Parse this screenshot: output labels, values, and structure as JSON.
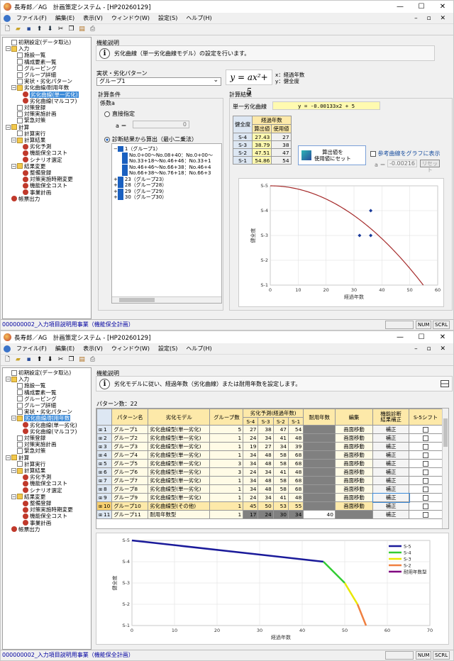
{
  "w1": {
    "title": "長寿郎／AG　計画策定システム - [HP20260129]",
    "menus": [
      "ファイル(F)",
      "編集(E)",
      "表示(V)",
      "ウィンドウ(W)",
      "設定(S)",
      "ヘルプ(H)"
    ],
    "status": "000000002_入力項目説明用事業（機能保全計画）",
    "status_num": "NUM",
    "status_scrl": "SCRL",
    "func_label": "機能説明",
    "func_text": "劣化曲線（単一劣化曲線モデル）の設定を行います。",
    "pattern_label": "実状・劣化パターン",
    "pattern_value": "グループ1",
    "formula_note_x": "x：経過年数",
    "formula_note_y": "y：健全度",
    "cond_label": "計算条件",
    "coef_label": "係数a",
    "radio_direct": "直接指定",
    "a_label": "a ＝",
    "a_value": "0",
    "radio_diag": "診断結果から算出（最小二乗法）",
    "subtree": [
      "1（グループ1）",
      "No.0+00～No.08+40：No.0+00～",
      "No.33+18～No.46+46：No.33+1",
      "No.46+46～No.66+38：No.46+4",
      "No.66+38～No.76+18：No.66+3",
      "23（グループ23）",
      "28（グループ28）",
      "29（グループ29）",
      "30（グループ30）"
    ],
    "result_label": "計算結果",
    "single_curve_label": "単一劣化曲線",
    "single_curve_eq": "y = -0.00133x2 + 5",
    "table_head_health": "健全度",
    "table_head_years": "経過年数",
    "table_head_calc": "算出値",
    "table_head_used": "使用値",
    "table_rows": [
      [
        "S-4",
        "27.43",
        "27"
      ],
      [
        "S-3",
        "38.79",
        "38"
      ],
      [
        "S-2",
        "47.51",
        "47"
      ],
      [
        "S-1",
        "54.86",
        "54"
      ]
    ],
    "btn_set": "算出値を\n使用値にセット",
    "ref_curve_label": "参考曲線をグラフに表示",
    "ref_a_label": "a ＝",
    "ref_a_value": "-0.00216",
    "reset_label": "リセット"
  },
  "tree": [
    {
      "label": "初期設定(データ取込)",
      "icon": "doc",
      "lvl": 1
    },
    {
      "label": "入力",
      "icon": "fold",
      "lvl": 0
    },
    {
      "label": "施設一覧",
      "icon": "doc",
      "lvl": 2
    },
    {
      "label": "構成要素一覧",
      "icon": "doc",
      "lvl": 2
    },
    {
      "label": "グルーピング",
      "icon": "doc",
      "lvl": 2
    },
    {
      "label": "グループ詳細",
      "icon": "doc",
      "lvl": 2
    },
    {
      "label": "実状・劣化パターン",
      "icon": "doc",
      "lvl": 2
    },
    {
      "label": "劣化曲線/耐用年数",
      "icon": "fold",
      "lvl": 1
    },
    {
      "label": "劣化曲線(単一劣化)",
      "icon": "red",
      "lvl": 3
    },
    {
      "label": "劣化曲線(マルコフ)",
      "icon": "red",
      "lvl": 3
    },
    {
      "label": "対策登録",
      "icon": "doc",
      "lvl": 2
    },
    {
      "label": "対策実施計画",
      "icon": "doc",
      "lvl": 2
    },
    {
      "label": "緊急対策",
      "icon": "doc",
      "lvl": 2
    },
    {
      "label": "計算",
      "icon": "fold",
      "lvl": 0
    },
    {
      "label": "計算実行",
      "icon": "doc",
      "lvl": 2
    },
    {
      "label": "計算結果",
      "icon": "fold",
      "lvl": 1
    },
    {
      "label": "劣化予測",
      "icon": "red",
      "lvl": 3
    },
    {
      "label": "機能保全コスト",
      "icon": "red",
      "lvl": 3
    },
    {
      "label": "シナリオ選定",
      "icon": "red",
      "lvl": 3
    },
    {
      "label": "結果変更",
      "icon": "fold",
      "lvl": 1
    },
    {
      "label": "整備登録",
      "icon": "red",
      "lvl": 3
    },
    {
      "label": "対策実施時期変更",
      "icon": "red",
      "lvl": 3
    },
    {
      "label": "機能保全コスト",
      "icon": "red",
      "lvl": 3
    },
    {
      "label": "事業計画",
      "icon": "red",
      "lvl": 3
    },
    {
      "label": "帳票出力",
      "icon": "red",
      "lvl": 1
    }
  ],
  "chart_data": [
    {
      "type": "line+scatter",
      "xlabel": "経過年数",
      "ylabel": "健全度",
      "xlim": [
        0,
        60
      ],
      "xticks": [
        "0",
        "10",
        "20",
        "30",
        "40",
        "50",
        "60"
      ],
      "yticks": [
        "S-1",
        "S-2",
        "S-3",
        "S-4",
        "S-5"
      ],
      "curve_a": -0.00133,
      "points": [
        [
          32,
          3
        ],
        [
          36,
          3
        ],
        [
          36,
          4
        ]
      ]
    },
    {
      "type": "line",
      "xlabel": "経過年数",
      "ylabel": "健全度",
      "xlim": [
        0,
        70
      ],
      "xticks": [
        "0",
        "10",
        "20",
        "30",
        "40",
        "50",
        "60",
        "70"
      ],
      "yticks": [
        "S-1",
        "S-2",
        "S-3",
        "S-4",
        "S-5"
      ],
      "series": [
        {
          "name": "S-5",
          "color": "#1a1a9a",
          "points": [
            [
              0,
              5
            ],
            [
              45,
              4
            ]
          ]
        },
        {
          "name": "S-4",
          "color": "#33cc33",
          "points": [
            [
              45,
              4
            ],
            [
              50,
              3
            ]
          ]
        },
        {
          "name": "S-3",
          "color": "#e8e800",
          "points": [
            [
              50,
              3
            ],
            [
              53,
              2
            ]
          ]
        },
        {
          "name": "S-2",
          "color": "#f08040",
          "points": [
            [
              53,
              2
            ],
            [
              55,
              1
            ]
          ]
        },
        {
          "name": "耐用年数型",
          "color": "#800080",
          "points": []
        }
      ]
    }
  ],
  "w2": {
    "title": "長寿郎／AG　計画策定システム - [HP20260129]",
    "func_label": "機能説明",
    "func_text": "劣化モデルに従い、経過年数（劣化曲線）または耐用年数を設定します。",
    "pattern_count": "パターン数：22",
    "headers": [
      "パターン名",
      "劣化モデル",
      "グループ数",
      "劣化予測(経過年数)",
      "S-4",
      "S-3",
      "S-2",
      "S-1",
      "耐用年数",
      "編集",
      "機能診断\n結果補正",
      "S-5シフト"
    ],
    "rows": [
      [
        "1",
        "グループ1",
        "劣化曲線型(単一劣化)",
        "5",
        "27",
        "38",
        "47",
        "54",
        "",
        "画面移動",
        "補正"
      ],
      [
        "2",
        "グループ2",
        "劣化曲線型(単一劣化)",
        "1",
        "24",
        "34",
        "41",
        "48",
        "",
        "画面移動",
        "補正"
      ],
      [
        "3",
        "グループ3",
        "劣化曲線型(単一劣化)",
        "1",
        "19",
        "27",
        "34",
        "39",
        "",
        "画面移動",
        "補正"
      ],
      [
        "4",
        "グループ4",
        "劣化曲線型(単一劣化)",
        "1",
        "34",
        "48",
        "58",
        "68",
        "",
        "画面移動",
        "補正"
      ],
      [
        "5",
        "グループ5",
        "劣化曲線型(単一劣化)",
        "3",
        "34",
        "48",
        "58",
        "68",
        "",
        "画面移動",
        "補正"
      ],
      [
        "6",
        "グループ6",
        "劣化曲線型(単一劣化)",
        "3",
        "24",
        "34",
        "41",
        "48",
        "",
        "画面移動",
        "補正"
      ],
      [
        "7",
        "グループ7",
        "劣化曲線型(単一劣化)",
        "1",
        "34",
        "48",
        "58",
        "68",
        "",
        "画面移動",
        "補正"
      ],
      [
        "8",
        "グループ8",
        "劣化曲線型(単一劣化)",
        "1",
        "34",
        "48",
        "58",
        "68",
        "",
        "画面移動",
        "補正"
      ],
      [
        "9",
        "グループ9",
        "劣化曲線型(単一劣化)",
        "1",
        "24",
        "34",
        "41",
        "48",
        "",
        "画面移動",
        "補正"
      ],
      [
        "10",
        "グループ10",
        "劣化曲線型(その他)",
        "1",
        "45",
        "50",
        "53",
        "55",
        "",
        "画面移動",
        "補正"
      ],
      [
        "11",
        "グループ11",
        "耐用年数型",
        "1",
        "17",
        "24",
        "30",
        "34",
        "40",
        "",
        "補正"
      ]
    ]
  }
}
